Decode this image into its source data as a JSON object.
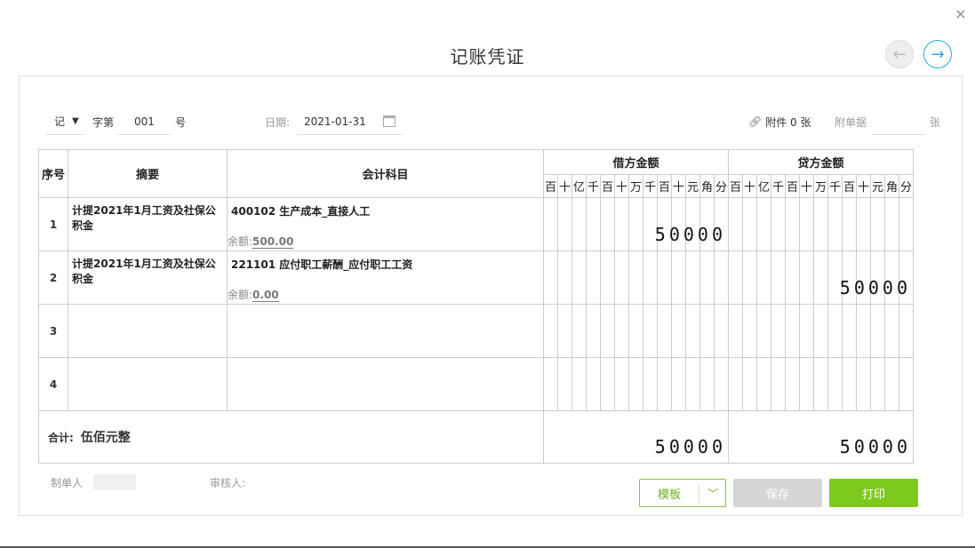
{
  "dialog": {
    "title": "记账凭证",
    "close_icon": "×",
    "prev_icon": "←",
    "next_icon": "→"
  },
  "header": {
    "voucher_word": "记",
    "zi_di": "字第",
    "number": "001",
    "hao": "号",
    "date_label": "日期:",
    "date_value": "2021-01-31",
    "attachment_label": "附件 0 张",
    "attach_doc_label": "附单据",
    "zhang": "张"
  },
  "table": {
    "headers": {
      "seq": "序号",
      "summary": "摘要",
      "subject": "会计科目",
      "debit": "借方金额",
      "credit": "贷方金额"
    },
    "digit_units": [
      "百",
      "十",
      "亿",
      "千",
      "百",
      "十",
      "万",
      "千",
      "百",
      "十",
      "元",
      "角",
      "分"
    ],
    "rows": [
      {
        "seq": "1",
        "summary": "计提2021年1月工资及社保公积金",
        "subject": "400102 生产成本_直接人工",
        "balance_label": "余额:",
        "balance": "500.00",
        "debit": "50000",
        "credit": ""
      },
      {
        "seq": "2",
        "summary": "计提2021年1月工资及社保公积金",
        "subject": "221101 应付职工薪酬_应付职工工资",
        "balance_label": "余额:",
        "balance": "0.00",
        "debit": "",
        "credit": "50000"
      },
      {
        "seq": "3",
        "summary": "",
        "subject": "",
        "balance_label": "",
        "balance": "",
        "debit": "",
        "credit": ""
      },
      {
        "seq": "4",
        "summary": "",
        "subject": "",
        "balance_label": "",
        "balance": "",
        "debit": "",
        "credit": ""
      }
    ],
    "total": {
      "label": "合计:",
      "in_words": "伍佰元整",
      "debit": "50000",
      "credit": "50000"
    }
  },
  "footer": {
    "maker_label": "制单人",
    "reviewer_label": "审核人:",
    "template_button": "模板",
    "save_button": "保存",
    "print_button": "打印"
  },
  "colors": {
    "accent_green": "#7ec91d",
    "accent_blue": "#2ea8e6"
  }
}
